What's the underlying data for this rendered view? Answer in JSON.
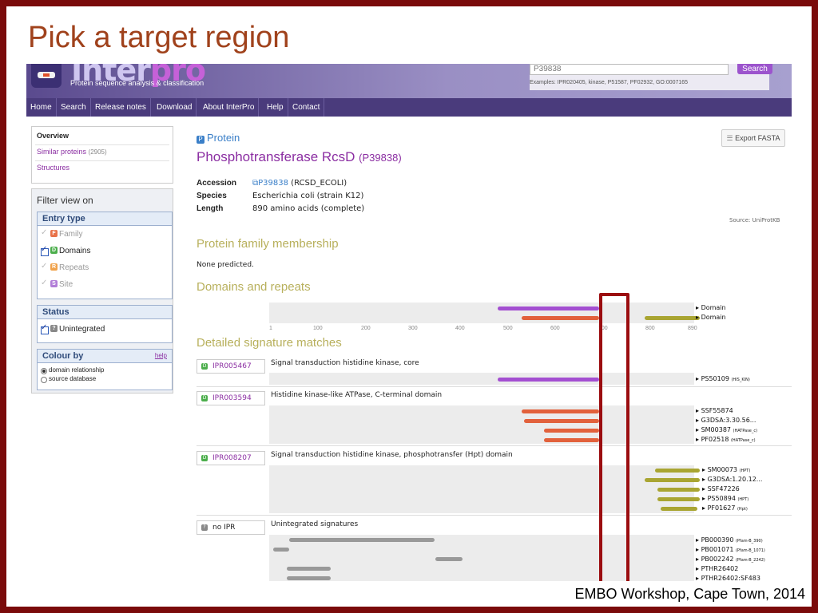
{
  "slide": {
    "title": "Pick a target region",
    "footer": "EMBO Workshop, Cape Town, 2014"
  },
  "header": {
    "logo_left": "Inter",
    "logo_right": "pro",
    "tagline": "Protein sequence analysis & classification",
    "search_value": "P39838",
    "search_button": "Search",
    "examples": "Examples: IPR020405, kinase, P51587, PF02932, GO:0007165"
  },
  "nav": [
    "Home",
    "Search",
    "Release notes",
    "Download",
    "About InterPro",
    "Help",
    "Contact"
  ],
  "sidebar": {
    "links": [
      {
        "label": "Overview",
        "count": ""
      },
      {
        "label": "Similar proteins",
        "count": "(2905)"
      },
      {
        "label": "Structures",
        "count": ""
      }
    ],
    "filter_title": "Filter view on",
    "entry_type_title": "Entry type",
    "entry_types": [
      {
        "badge": "F",
        "label": "Family",
        "color": "#e8734a"
      },
      {
        "badge": "D",
        "label": "Domains",
        "color": "#4cae4c"
      },
      {
        "badge": "R",
        "label": "Repeats",
        "color": "#f0a24b"
      },
      {
        "badge": "S",
        "label": "Site",
        "color": "#b27ed8"
      }
    ],
    "status_title": "Status",
    "status_label": "Unintegrated",
    "colour_title": "Colour by",
    "colour_help": "help",
    "colour_options": [
      "domain relationship",
      "source database"
    ]
  },
  "protein": {
    "kind": "Protein",
    "name": "Phosphotransferase RcsD",
    "accession_paren": "(P39838)",
    "export": "Export FASTA",
    "accession_label": "Accession",
    "accession": "P39838",
    "accession_id": "(RCSD_ECOLI)",
    "species_label": "Species",
    "species": "Escherichia coli (strain K12)",
    "length_label": "Length",
    "length": "890 amino acids (complete)",
    "source": "Source: UniProtKB"
  },
  "family_section": {
    "title": "Protein family membership",
    "text": "None predicted."
  },
  "domains_section": {
    "title": "Domains and repeats",
    "labels": [
      "Domain",
      "Domain"
    ],
    "ticks": [
      "1",
      "100",
      "200",
      "300",
      "400",
      "500",
      "600",
      "700",
      "800",
      "890"
    ]
  },
  "detailed_title": "Detailed signature matches",
  "entries": [
    {
      "id": "IPR005467",
      "desc": "Signal transduction histidine kinase, core",
      "signatures": [
        {
          "name": "PS50109",
          "sub": "(HIS_KIN)"
        }
      ]
    },
    {
      "id": "IPR003594",
      "desc": "Histidine kinase-like ATPase, C-terminal domain",
      "signatures": [
        {
          "name": "SSF55874",
          "sub": ""
        },
        {
          "name": "G3DSA:3.30.56...",
          "sub": ""
        },
        {
          "name": "SM00387",
          "sub": "(HATPase_c)"
        },
        {
          "name": "PF02518",
          "sub": "(HATPase_c)"
        }
      ]
    },
    {
      "id": "IPR008207",
      "desc": "Signal transduction histidine kinase, phosphotransfer (Hpt) domain",
      "signatures": [
        {
          "name": "SM00073",
          "sub": "(HPT)"
        },
        {
          "name": "G3DSA:1.20.12...",
          "sub": ""
        },
        {
          "name": "SSF47226",
          "sub": ""
        },
        {
          "name": "PS50894",
          "sub": "(HPT)"
        },
        {
          "name": "PF01627",
          "sub": "(Hpt)"
        }
      ]
    },
    {
      "id": "no IPR",
      "desc": "Unintegrated signatures",
      "signatures": [
        {
          "name": "PB000390",
          "sub": "(Pfam-B_390)"
        },
        {
          "name": "PB001071",
          "sub": "(Pfam-B_1071)"
        },
        {
          "name": "PB002242",
          "sub": "(Pfam-B_2242)"
        },
        {
          "name": "PTHR26402",
          "sub": ""
        },
        {
          "name": "PTHR26402:SF483",
          "sub": ""
        }
      ]
    }
  ],
  "colors": {
    "purple": "#a34fd1",
    "orange": "#e2613c",
    "olive": "#a9a532",
    "grey": "#999999",
    "highlight": "#9b0d10"
  }
}
